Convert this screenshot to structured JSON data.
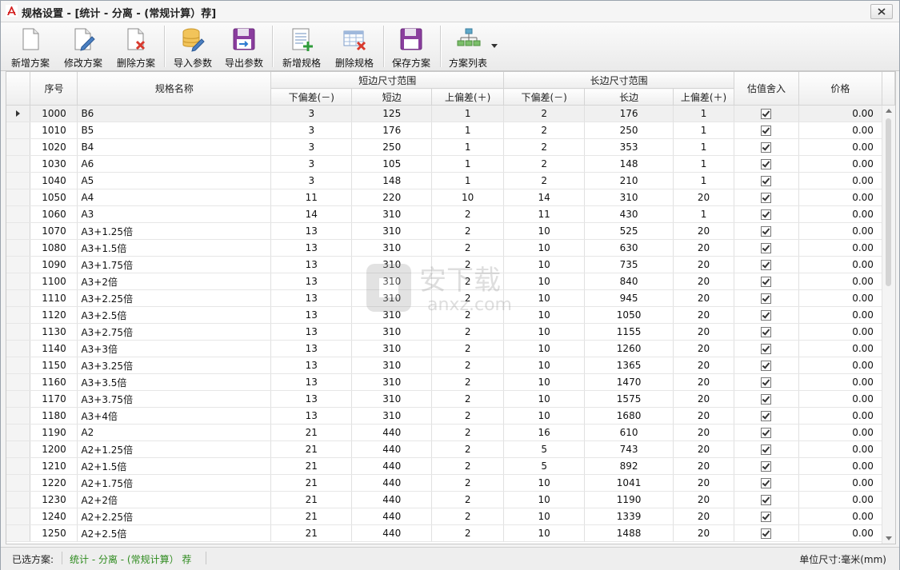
{
  "window": {
    "title": "规格设置 - [统计 - 分离 - (常规计算）荐]"
  },
  "toolbar": {
    "new_scheme": "新增方案",
    "edit_scheme": "修改方案",
    "delete_scheme": "删除方案",
    "import_params": "导入参数",
    "export_params": "导出参数",
    "new_spec": "新增规格",
    "delete_spec": "删除规格",
    "save_scheme": "保存方案",
    "scheme_list": "方案列表"
  },
  "grid": {
    "headers": {
      "seq": "序号",
      "name": "规格名称",
      "short_group": "短边尺寸范围",
      "long_group": "长边尺寸范围",
      "lower_tol": "下偏差(－)",
      "short_side": "短边",
      "upper_tol": "上偏差(＋)",
      "long_side": "长边",
      "rounding": "估值舍入",
      "price": "价格"
    },
    "rows": [
      {
        "seq": "1000",
        "name": "B6",
        "s_lo": "3",
        "s": "125",
        "s_up": "1",
        "l_lo": "2",
        "l": "176",
        "l_up": "1",
        "price": "0.00"
      },
      {
        "seq": "1010",
        "name": "B5",
        "s_lo": "3",
        "s": "176",
        "s_up": "1",
        "l_lo": "2",
        "l": "250",
        "l_up": "1",
        "price": "0.00"
      },
      {
        "seq": "1020",
        "name": "B4",
        "s_lo": "3",
        "s": "250",
        "s_up": "1",
        "l_lo": "2",
        "l": "353",
        "l_up": "1",
        "price": "0.00"
      },
      {
        "seq": "1030",
        "name": "A6",
        "s_lo": "3",
        "s": "105",
        "s_up": "1",
        "l_lo": "2",
        "l": "148",
        "l_up": "1",
        "price": "0.00"
      },
      {
        "seq": "1040",
        "name": "A5",
        "s_lo": "3",
        "s": "148",
        "s_up": "1",
        "l_lo": "2",
        "l": "210",
        "l_up": "1",
        "price": "0.00"
      },
      {
        "seq": "1050",
        "name": "A4",
        "s_lo": "11",
        "s": "220",
        "s_up": "10",
        "l_lo": "14",
        "l": "310",
        "l_up": "20",
        "price": "0.00"
      },
      {
        "seq": "1060",
        "name": "A3",
        "s_lo": "14",
        "s": "310",
        "s_up": "2",
        "l_lo": "11",
        "l": "430",
        "l_up": "1",
        "price": "0.00"
      },
      {
        "seq": "1070",
        "name": "A3+1.25倍",
        "s_lo": "13",
        "s": "310",
        "s_up": "2",
        "l_lo": "10",
        "l": "525",
        "l_up": "20",
        "price": "0.00"
      },
      {
        "seq": "1080",
        "name": "A3+1.5倍",
        "s_lo": "13",
        "s": "310",
        "s_up": "2",
        "l_lo": "10",
        "l": "630",
        "l_up": "20",
        "price": "0.00"
      },
      {
        "seq": "1090",
        "name": "A3+1.75倍",
        "s_lo": "13",
        "s": "310",
        "s_up": "2",
        "l_lo": "10",
        "l": "735",
        "l_up": "20",
        "price": "0.00"
      },
      {
        "seq": "1100",
        "name": "A3+2倍",
        "s_lo": "13",
        "s": "310",
        "s_up": "2",
        "l_lo": "10",
        "l": "840",
        "l_up": "20",
        "price": "0.00"
      },
      {
        "seq": "1110",
        "name": "A3+2.25倍",
        "s_lo": "13",
        "s": "310",
        "s_up": "2",
        "l_lo": "10",
        "l": "945",
        "l_up": "20",
        "price": "0.00"
      },
      {
        "seq": "1120",
        "name": "A3+2.5倍",
        "s_lo": "13",
        "s": "310",
        "s_up": "2",
        "l_lo": "10",
        "l": "1050",
        "l_up": "20",
        "price": "0.00"
      },
      {
        "seq": "1130",
        "name": "A3+2.75倍",
        "s_lo": "13",
        "s": "310",
        "s_up": "2",
        "l_lo": "10",
        "l": "1155",
        "l_up": "20",
        "price": "0.00"
      },
      {
        "seq": "1140",
        "name": "A3+3倍",
        "s_lo": "13",
        "s": "310",
        "s_up": "2",
        "l_lo": "10",
        "l": "1260",
        "l_up": "20",
        "price": "0.00"
      },
      {
        "seq": "1150",
        "name": "A3+3.25倍",
        "s_lo": "13",
        "s": "310",
        "s_up": "2",
        "l_lo": "10",
        "l": "1365",
        "l_up": "20",
        "price": "0.00"
      },
      {
        "seq": "1160",
        "name": "A3+3.5倍",
        "s_lo": "13",
        "s": "310",
        "s_up": "2",
        "l_lo": "10",
        "l": "1470",
        "l_up": "20",
        "price": "0.00"
      },
      {
        "seq": "1170",
        "name": "A3+3.75倍",
        "s_lo": "13",
        "s": "310",
        "s_up": "2",
        "l_lo": "10",
        "l": "1575",
        "l_up": "20",
        "price": "0.00"
      },
      {
        "seq": "1180",
        "name": "A3+4倍",
        "s_lo": "13",
        "s": "310",
        "s_up": "2",
        "l_lo": "10",
        "l": "1680",
        "l_up": "20",
        "price": "0.00"
      },
      {
        "seq": "1190",
        "name": "A2",
        "s_lo": "21",
        "s": "440",
        "s_up": "2",
        "l_lo": "16",
        "l": "610",
        "l_up": "20",
        "price": "0.00"
      },
      {
        "seq": "1200",
        "name": "A2+1.25倍",
        "s_lo": "21",
        "s": "440",
        "s_up": "2",
        "l_lo": "5",
        "l": "743",
        "l_up": "20",
        "price": "0.00"
      },
      {
        "seq": "1210",
        "name": "A2+1.5倍",
        "s_lo": "21",
        "s": "440",
        "s_up": "2",
        "l_lo": "5",
        "l": "892",
        "l_up": "20",
        "price": "0.00"
      },
      {
        "seq": "1220",
        "name": "A2+1.75倍",
        "s_lo": "21",
        "s": "440",
        "s_up": "2",
        "l_lo": "10",
        "l": "1041",
        "l_up": "20",
        "price": "0.00"
      },
      {
        "seq": "1230",
        "name": "A2+2倍",
        "s_lo": "21",
        "s": "440",
        "s_up": "2",
        "l_lo": "10",
        "l": "1190",
        "l_up": "20",
        "price": "0.00"
      },
      {
        "seq": "1240",
        "name": "A2+2.25倍",
        "s_lo": "21",
        "s": "440",
        "s_up": "2",
        "l_lo": "10",
        "l": "1339",
        "l_up": "20",
        "price": "0.00"
      },
      {
        "seq": "1250",
        "name": "A2+2.5倍",
        "s_lo": "21",
        "s": "440",
        "s_up": "2",
        "l_lo": "10",
        "l": "1488",
        "l_up": "20",
        "price": "0.00"
      }
    ]
  },
  "watermark": {
    "text_cn": "安下载",
    "text_en": "anxz.com"
  },
  "statusbar": {
    "label": "已选方案:",
    "scheme": "统计 - 分离 - (常规计算）  荐",
    "unit": "单位尺寸:毫米(mm)"
  },
  "colors": {
    "status_scheme": "#2e8b1e",
    "header_bg": "#eeeeee"
  }
}
